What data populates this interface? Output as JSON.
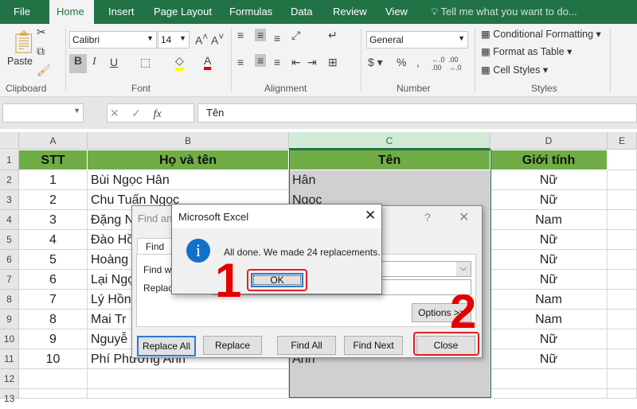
{
  "tabs": [
    "File",
    "Home",
    "Insert",
    "Page Layout",
    "Formulas",
    "Data",
    "Review",
    "View"
  ],
  "tell_me": "Tell me what you want to do...",
  "ribbon": {
    "paste": "Paste",
    "font_name": "Calibri",
    "font_size": "14",
    "number_format": "General",
    "conditional_formatting": "Conditional Formatting",
    "format_as_table": "Format as Table",
    "cell_styles": "Cell Styles",
    "groups": [
      "Clipboard",
      "Font",
      "Alignment",
      "Number",
      "Styles"
    ],
    "bold": "B",
    "italic": "I",
    "underline": "U"
  },
  "formula_bar": {
    "name_box": "",
    "fx": "fx",
    "content": "Tên"
  },
  "columns": [
    "A",
    "B",
    "C",
    "D",
    "E"
  ],
  "rows": [
    "1",
    "2",
    "3",
    "4",
    "5",
    "6",
    "7",
    "8",
    "9",
    "10",
    "11",
    "12",
    "13"
  ],
  "table": {
    "headers": [
      "STT",
      "Họ và tên",
      "Tên",
      "Giới tính"
    ],
    "data": [
      [
        "1",
        "Bùi Ngọc Hân",
        "Hân",
        "Nữ"
      ],
      [
        "2",
        "Chu Tuấn Ngọc",
        "Ngọc",
        "Nữ"
      ],
      [
        "3",
        "Đặng N",
        "",
        "Nam"
      ],
      [
        "4",
        "Đào Hồ",
        "",
        "Nữ"
      ],
      [
        "5",
        "Hoàng",
        "",
        "Nữ"
      ],
      [
        "6",
        "Lại Ngọ",
        "",
        "Nữ"
      ],
      [
        "7",
        "Lý Hồn",
        "",
        "Nam"
      ],
      [
        "8",
        "Mai Tr",
        "",
        "Nam"
      ],
      [
        "9",
        "Nguyễ",
        "",
        "Nữ"
      ],
      [
        "10",
        "Phí Phương Anh",
        "Anh",
        "Nữ"
      ]
    ]
  },
  "find_dialog": {
    "title": "Find and Replace",
    "help": "?",
    "tab_find": "Find",
    "find_what": "Find what:",
    "replace_with": "Replace with:",
    "options": "Options >>",
    "buttons": [
      "Replace All",
      "Replace",
      "Find All",
      "Find Next",
      "Close"
    ]
  },
  "msgbox": {
    "title": "Microsoft Excel",
    "message": "All done. We made 24 replacements.",
    "ok": "OK"
  },
  "annotations": [
    "1",
    "2"
  ],
  "colors": {
    "excel_green": "#217346",
    "header_fill": "#70ad47",
    "annotation_red": "#e50000"
  }
}
